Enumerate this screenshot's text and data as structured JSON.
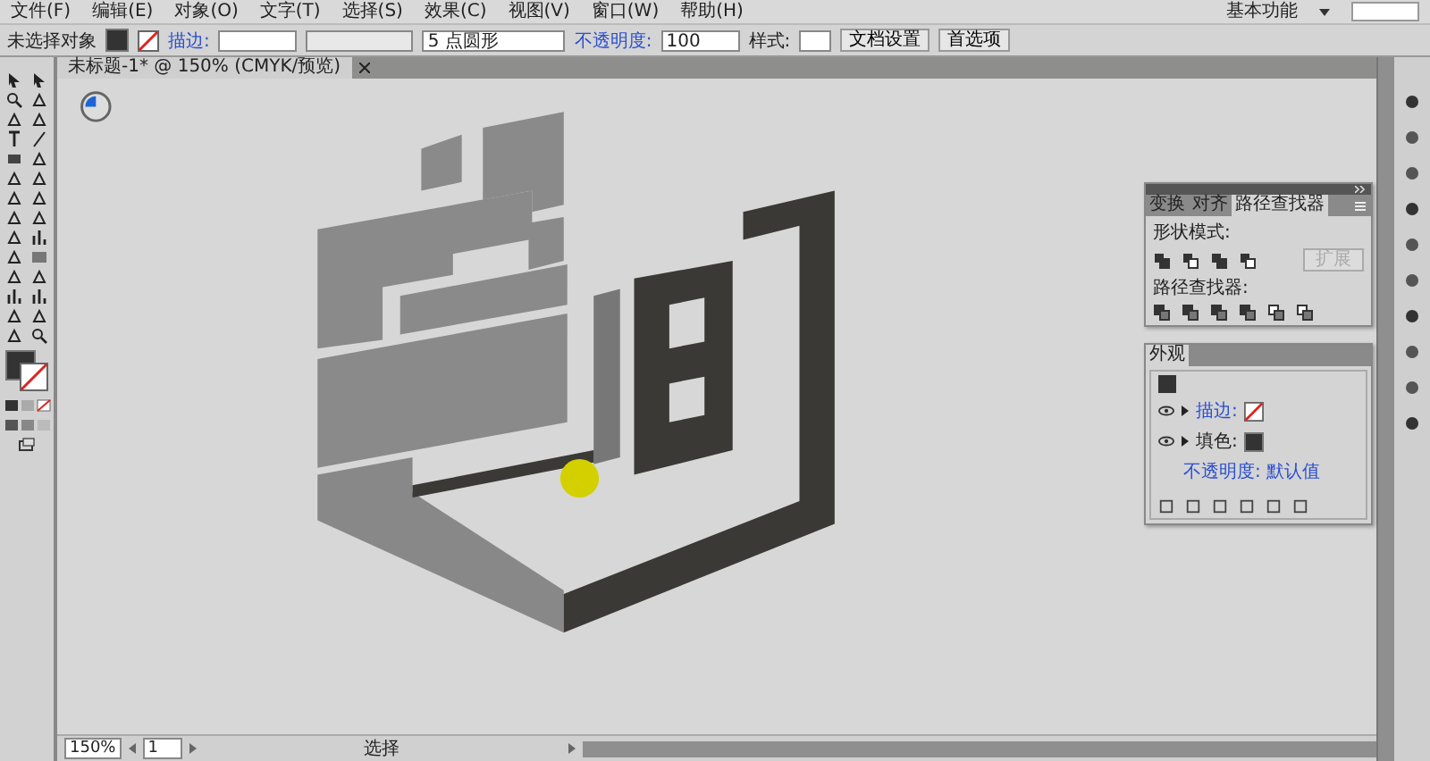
{
  "menu_bar": {
    "items": [
      "文件(F)",
      "编辑(E)",
      "对象(O)",
      "文字(T)",
      "选择(S)",
      "效果(C)",
      "视图(V)",
      "窗口(W)",
      "帮助(H)"
    ],
    "workspace": "基本功能"
  },
  "control_bar": {
    "selection_label": "未选择对象",
    "stroke_label": "描边:",
    "brush": "5 点圆形",
    "opacity_label": "不透明度:",
    "opacity_value": "100",
    "style_label": "样式:",
    "buttons": [
      "文档设置",
      "首选项"
    ]
  },
  "document_tab": {
    "title": "未标题-1* @ 150% (CMYK/预览)"
  },
  "pathfinder_panel": {
    "tabs": [
      {
        "label": "变换",
        "selected": false
      },
      {
        "label": "对齐",
        "selected": false
      },
      {
        "label": "路径查找器",
        "selected": true
      }
    ],
    "shape_modes_label": "形状模式:",
    "expand_button": {
      "label": "扩展",
      "disabled": true
    },
    "pathfinders_label": "路径查找器:"
  },
  "appearance_panel": {
    "title": "外观",
    "rows": [
      {
        "label": "描边:",
        "kind": "stroke"
      },
      {
        "label": "填色:",
        "kind": "fill"
      }
    ],
    "opacity": "不透明度: 默认值"
  },
  "status_bar": {
    "zoom": "150%",
    "artboard": "1",
    "tool": "选择"
  }
}
